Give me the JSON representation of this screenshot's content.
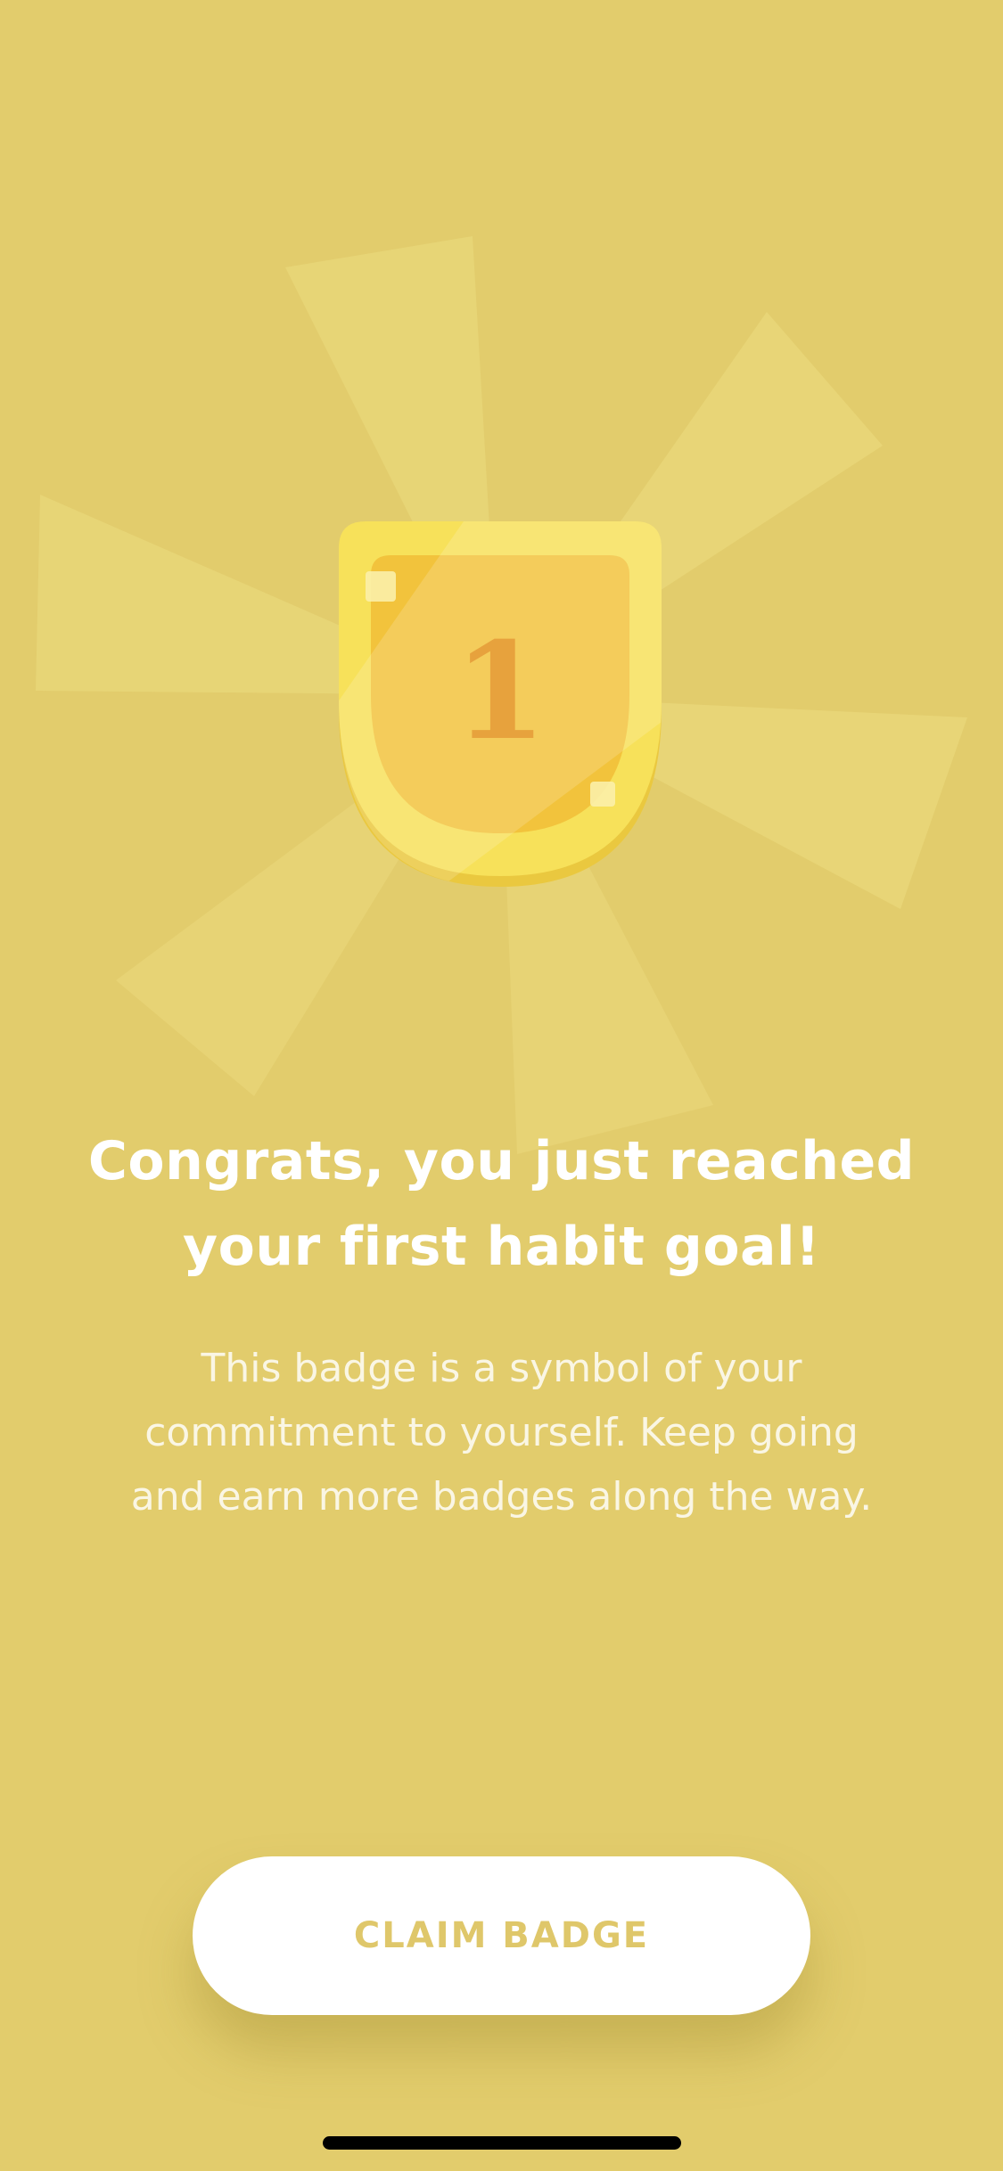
{
  "badge": {
    "number": "1",
    "colors": {
      "outer_rim": "#f7e15a",
      "rim_shadow": "#eac83f",
      "inner_face": "#f2c33c",
      "numeral": "#e7a23d",
      "rays": "#f2e48a"
    }
  },
  "message": {
    "title_line1": "Congrats, you just reached",
    "title_line2": "your first habit goal!",
    "body_line1": "This badge is a symbol of your",
    "body_line2": "commitment to yourself. Keep going",
    "body_line3": "and earn more badges along the way."
  },
  "actions": {
    "claim_label": "CLAIM BADGE"
  },
  "theme": {
    "background": "#e2cc6c",
    "button_bg": "#ffffff",
    "button_text": "#dfc76a",
    "text": "#ffffff"
  }
}
